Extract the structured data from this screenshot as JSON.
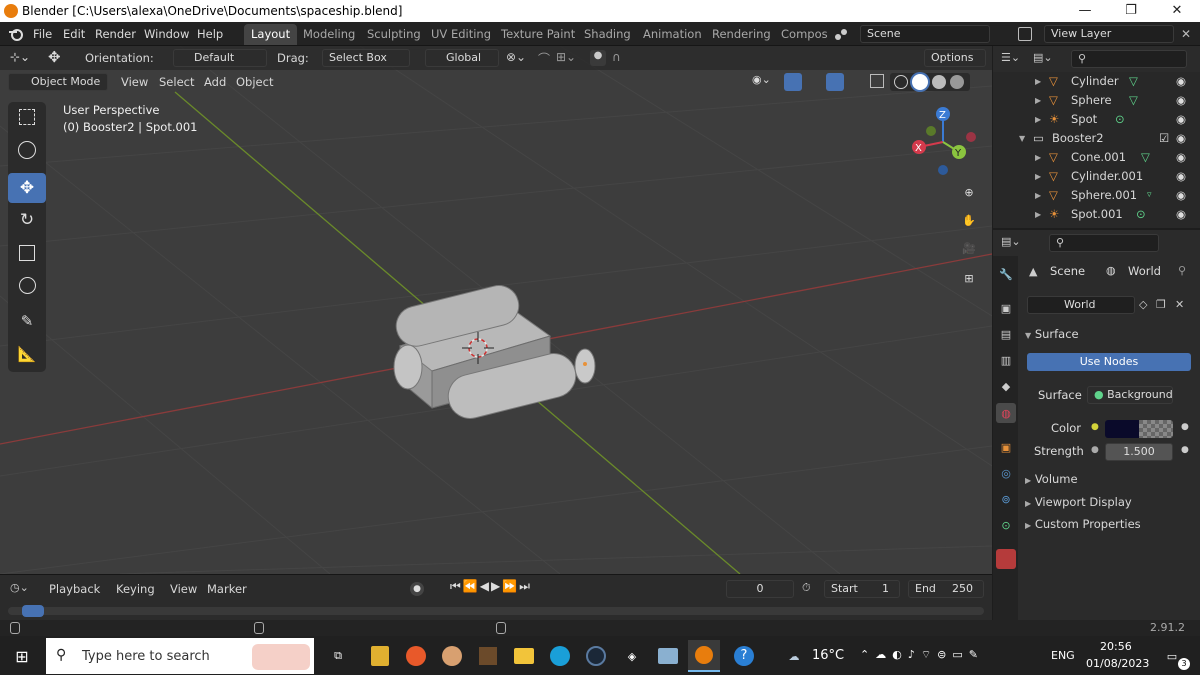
{
  "window": {
    "title": "Blender [C:\\Users\\alexa\\OneDrive\\Documents\\spaceship.blend]",
    "minimize": "—",
    "maximize": "❐",
    "close": "✕"
  },
  "menu": [
    "File",
    "Edit",
    "Render",
    "Window",
    "Help"
  ],
  "workspaces": [
    {
      "label": "Layout",
      "active": true
    },
    {
      "label": "Modeling"
    },
    {
      "label": "Sculpting"
    },
    {
      "label": "UV Editing"
    },
    {
      "label": "Texture Paint"
    },
    {
      "label": "Shading"
    },
    {
      "label": "Animation"
    },
    {
      "label": "Rendering"
    },
    {
      "label": "Compos"
    }
  ],
  "scene_field": "Scene",
  "view_layer_field": "View Layer",
  "tool_header": {
    "orientation_label": "Orientation:",
    "orientation_value": "Default",
    "drag_label": "Drag:",
    "drag_value": "Select Box",
    "transform_value": "Global",
    "options": "Options"
  },
  "viewport_header": {
    "mode": "Object Mode",
    "items": [
      "View",
      "Select",
      "Add",
      "Object"
    ]
  },
  "viewport_overlay": {
    "line1": "User Perspective",
    "line2": "(0) Booster2 | Spot.001"
  },
  "gizmo": {
    "x": "X",
    "y": "Y",
    "z": "Z"
  },
  "outliner": {
    "rows": [
      {
        "label": "Cylinder",
        "icon": "mesh-icon"
      },
      {
        "label": "Sphere",
        "icon": "mesh-icon"
      },
      {
        "label": "Spot",
        "icon": "light-icon"
      },
      {
        "label": "Booster2",
        "icon": "collection-icon"
      },
      {
        "label": "Cone.001",
        "icon": "mesh-icon"
      },
      {
        "label": "Cylinder.001",
        "icon": "mesh-icon"
      },
      {
        "label": "Sphere.001",
        "icon": "mesh-icon"
      },
      {
        "label": "Spot.001",
        "icon": "light-icon"
      }
    ]
  },
  "properties": {
    "scene": "Scene",
    "world": "World",
    "world_field": "World",
    "surface_section": "Surface",
    "use_nodes": "Use Nodes",
    "surface_label": "Surface",
    "surface_value": "Background",
    "color_label": "Color",
    "strength_label": "Strength",
    "strength_value": "1.500",
    "sections": [
      "Volume",
      "Viewport Display",
      "Custom Properties"
    ],
    "accent": "#4772b3"
  },
  "timeline": {
    "items": [
      "Playback",
      "Keying",
      "View",
      "Marker"
    ],
    "current_frame": "0",
    "start_label": "Start",
    "start_value": "1",
    "end_label": "End",
    "end_value": "250"
  },
  "status": {
    "version": "2.91.2"
  },
  "taskbar": {
    "search_placeholder": "Type here to search",
    "weather": "16°C",
    "lang": "ENG",
    "time": "20:56",
    "date": "01/08/2023",
    "notif_count": "3"
  }
}
